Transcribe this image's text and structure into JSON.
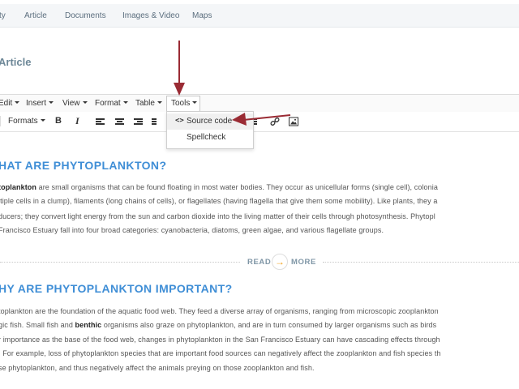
{
  "nav_tabs": [
    "ty",
    "Article",
    "Documents",
    "Images & Video",
    "Maps"
  ],
  "page_title": "Article",
  "menubar": {
    "items": [
      "Edit",
      "Insert",
      "View",
      "Format",
      "Table",
      "Tools"
    ]
  },
  "toolbar": {
    "formats_label": "Formats",
    "bold_label": "B",
    "italic_label": "I"
  },
  "tools_menu": {
    "items": [
      "Source code",
      "Spellcheck"
    ],
    "source_code_prefix": "<>"
  },
  "article": {
    "section1": {
      "heading": "HAT ARE PHYTOPLANKTON?",
      "lines": [
        "",
        "ltiple cells in a clump), filaments (long chains of cells), or flagellates (having flagella that give them some mobility). Like plants, they a",
        "ducers; they convert light energy from the sun and carbon dioxide into the living matter of their cells through photosynthesis. Phytopl",
        " Francisco Estuary fall into four broad categories: cyanobacteria, diatoms, green algae, and various flagellate groups."
      ],
      "line1_bold": "toplankton",
      "line1_rest": " are small organisms that can be found floating in most water bodies. They occur as unicellular forms (single cell), colonia"
    },
    "read_more": {
      "left": "READ",
      "right": "MORE",
      "arrow": "→"
    },
    "section2": {
      "heading": "HY ARE PHYTOPLANKTON IMPORTANT?",
      "line1": "toplankton are the foundation of the aquatic food web. They feed a diverse array of organisms, ranging from microscopic zooplankton",
      "line2_a": "gic fish. Small fish and ",
      "line2_bold": "benthic",
      "line2_b": " organisms also graze on phytoplankton, and are in turn consumed by larger organisms such as birds",
      "line3": "r importance as the base of the food web, changes in phytoplankton in the San Francisco Estuary can have cascading effects through",
      "line4": ". For example, loss of phytoplankton species that are important food sources can negatively affect the zooplankton and fish species th",
      "line5": "se phytoplankton, and thus negatively affect the animals preying on those zooplankton and fish."
    }
  },
  "colors": {
    "heading": "#3f8ed6",
    "annotation_arrow": "#9a2b34",
    "read_more_arrow": "#f2a21b"
  }
}
